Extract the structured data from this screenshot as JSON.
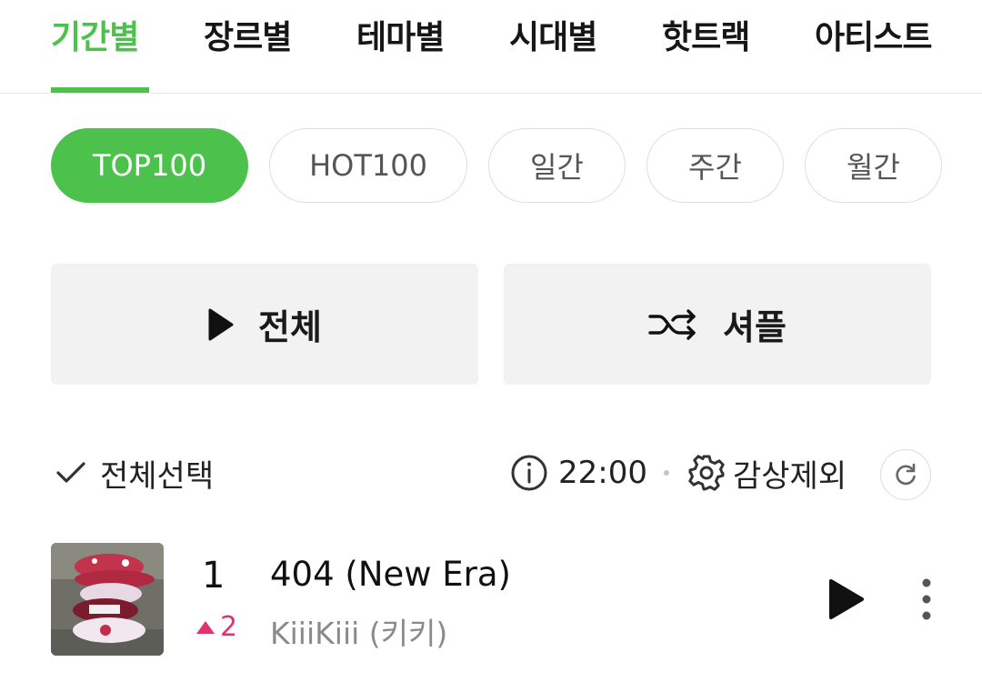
{
  "tabs": [
    {
      "label": "기간별",
      "active": true
    },
    {
      "label": "장르별",
      "active": false
    },
    {
      "label": "테마별",
      "active": false
    },
    {
      "label": "시대별",
      "active": false
    },
    {
      "label": "핫트랙",
      "active": false
    },
    {
      "label": "아티스트",
      "active": false
    }
  ],
  "chips": [
    {
      "label": "TOP100",
      "active": true
    },
    {
      "label": "HOT100",
      "active": false
    },
    {
      "label": "일간",
      "active": false
    },
    {
      "label": "주간",
      "active": false
    },
    {
      "label": "월간",
      "active": false
    }
  ],
  "actions": {
    "play_all_label": "전체",
    "shuffle_label": "셔플"
  },
  "toolbar": {
    "select_all_label": "전체선택",
    "update_time": "22:00",
    "exclude_label": "감상제외"
  },
  "songs": [
    {
      "rank": "1",
      "change": "2",
      "change_direction": "up",
      "title": "404 (New Era)",
      "artist": "KiiiKiii (키키)"
    }
  ],
  "colors": {
    "accent": "#4cc24c",
    "rank_up": "#e2336e"
  },
  "icons": [
    "play-icon",
    "shuffle-icon",
    "check-icon",
    "info-icon",
    "gear-icon",
    "refresh-icon",
    "more-vertical-icon"
  ]
}
